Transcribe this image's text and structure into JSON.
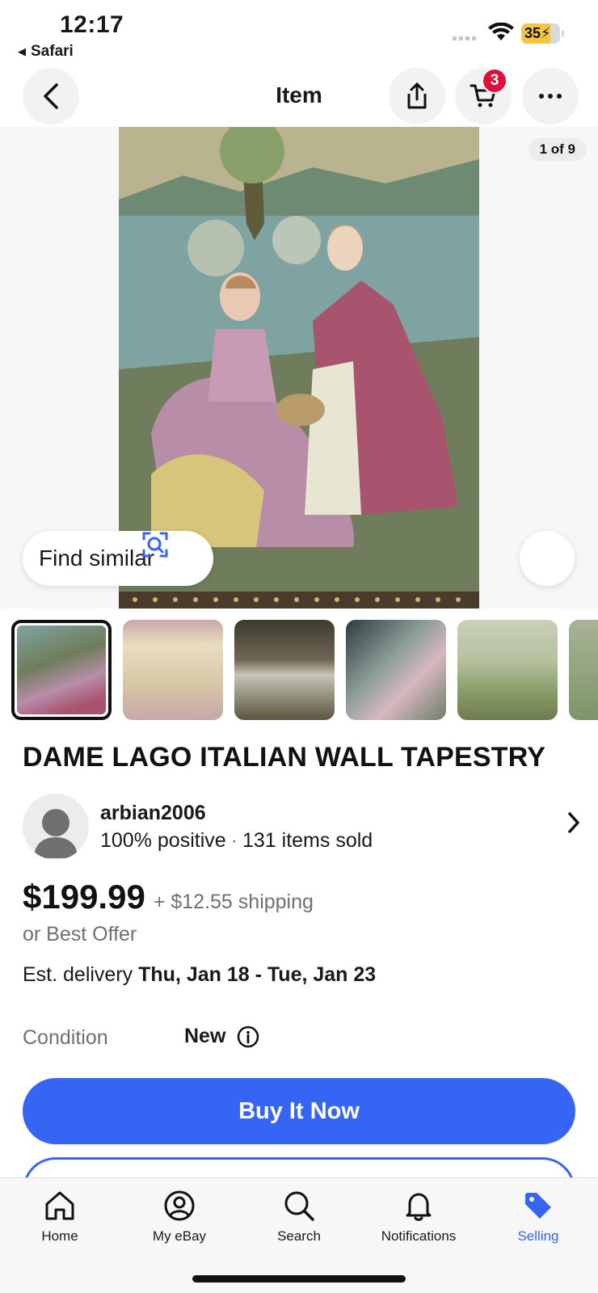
{
  "status_bar": {
    "time": "12:17",
    "back_app": "Safari",
    "battery": "35"
  },
  "nav": {
    "title": "Item",
    "cart_count": "3",
    "icons": [
      "back-icon",
      "share-icon",
      "cart-icon",
      "more-icon"
    ]
  },
  "gallery": {
    "counter": "1 of 9",
    "find_similar": "Find similar",
    "thumbnail_count": 6
  },
  "listing": {
    "title": "DAME LAGO ITALIAN WALL TAPESTRY",
    "seller": {
      "name": "arbian2006",
      "feedback": "100% positive",
      "separator": "·",
      "sold": "131 items sold"
    },
    "price": "$199.99",
    "shipping": "+ $12.55 shipping",
    "best_offer": "or Best Offer",
    "delivery_label": "Est. delivery",
    "delivery_dates": "Thu, Jan 18 - Tue, Jan 23",
    "condition_label": "Condition",
    "condition_value": "New"
  },
  "actions": {
    "buy_now": "Buy It Now"
  },
  "tabbar": {
    "items": [
      {
        "label": "Home",
        "icon": "home-icon"
      },
      {
        "label": "My eBay",
        "icon": "profile-icon"
      },
      {
        "label": "Search",
        "icon": "search-icon"
      },
      {
        "label": "Notifications",
        "icon": "bell-icon"
      },
      {
        "label": "Selling",
        "icon": "tag-icon"
      }
    ],
    "active": "Selling"
  },
  "colors": {
    "accent": "#3665f3",
    "badge": "#e0103a",
    "text": "#191919",
    "muted": "#707070"
  }
}
